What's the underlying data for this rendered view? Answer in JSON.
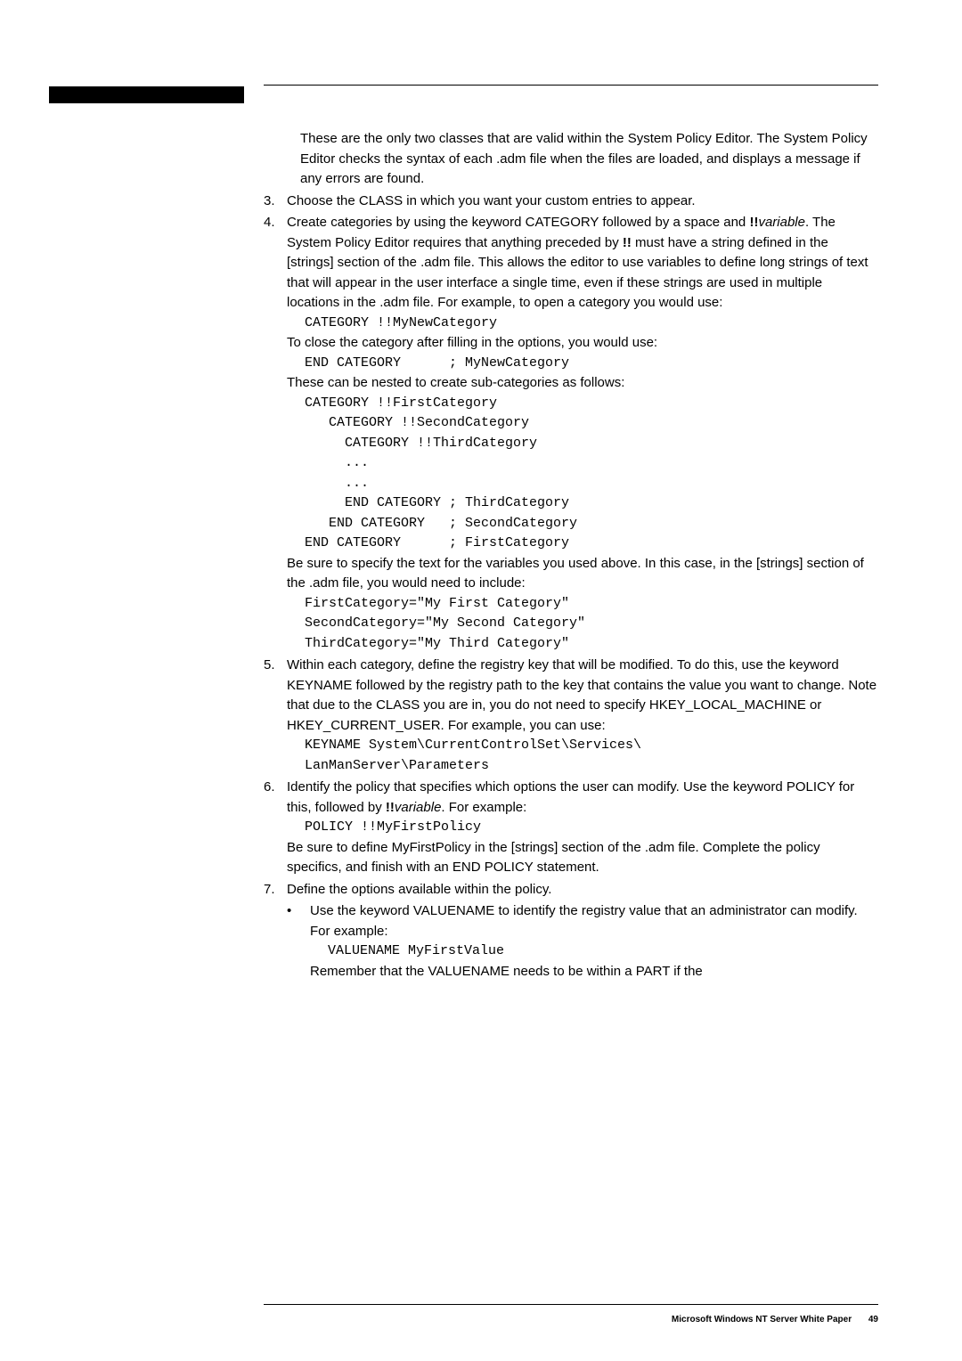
{
  "intro": {
    "p1": "These are the only two classes that are valid within the System Policy Editor. The System Policy Editor checks the syntax of each .adm file when the files are loaded, and displays a message if any errors are found."
  },
  "item3": {
    "num": "3.",
    "text": "Choose the CLASS in which you want your custom entries to appear."
  },
  "item4": {
    "num": "4.",
    "p1a": "Create categories by using the keyword CATEGORY followed by a space and ",
    "bold1": "!!",
    "italic1": "variable",
    "p1b": ". The System Policy Editor requires that anything preceded by ",
    "bold2": "!!",
    "p1c": " must have a string defined in the [strings] section of the .adm file. This allows the editor to use variables to define long strings of text that will appear in the user interface a single time, even if these strings are used in multiple locations in the .adm file. For example, to open a category you would use:",
    "code1": "CATEGORY !!MyNewCategory",
    "p2": "To close the category after filling in the options, you would use:",
    "code2": "END CATEGORY      ; MyNewCategory",
    "p3": "These can be nested to create sub-categories as follows:",
    "code3": "CATEGORY !!FirstCategory\n   CATEGORY !!SecondCategory\n     CATEGORY !!ThirdCategory\n     ...\n     ...\n     END CATEGORY ; ThirdCategory\n   END CATEGORY   ; SecondCategory\nEND CATEGORY      ; FirstCategory",
    "p4": "Be sure to specify the text for the variables you used above. In this case, in the [strings] section of the .adm file, you would need to include:",
    "code4": "FirstCategory=\"My First Category\"\nSecondCategory=\"My Second Category\"\nThirdCategory=\"My Third Category\""
  },
  "item5": {
    "num": "5.",
    "p1": "Within each category, define the registry key that will be modified. To do this, use the keyword KEYNAME followed by the registry path to the key that contains the value you want to change. Note that due to the CLASS you are in, you do not need to specify HKEY_LOCAL_MACHINE or HKEY_CURRENT_USER. For example, you can use:",
    "code1": "KEYNAME System\\CurrentControlSet\\Services\\\nLanManServer\\Parameters"
  },
  "item6": {
    "num": "6.",
    "p1a": "Identify the policy that specifies which options the user can modify. Use the keyword POLICY for this, followed by ",
    "bold1": "!!",
    "italic1": "variable",
    "p1b": ". For example:",
    "code1": "POLICY !!MyFirstPolicy",
    "p2": "Be sure to define MyFirstPolicy in the [strings] section of the .adm file. Complete the policy specifics, and finish with an END POLICY statement."
  },
  "item7": {
    "num": "7.",
    "p1": "Define the options available within the policy.",
    "bullet": "•",
    "sub1": "Use the keyword VALUENAME to identify the registry value that an administrator can modify. For example:",
    "code1": "VALUENAME MyFirstValue",
    "sub2": "Remember that the VALUENAME needs to be within a PART if the"
  },
  "footer": {
    "title": "Microsoft Windows NT Server White Paper",
    "page": "49"
  }
}
